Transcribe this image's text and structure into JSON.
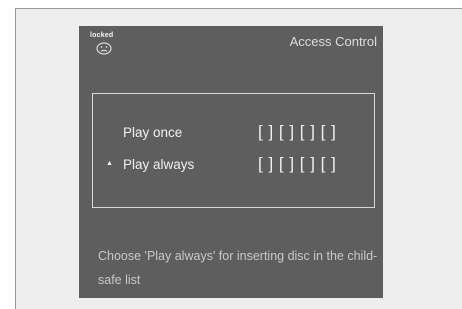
{
  "screen": {
    "title": "Access Control",
    "lock_status": {
      "label": "locked",
      "icon": "sad-face-icon"
    },
    "options": [
      {
        "label": "Play once",
        "code_slots": "[ ] [ ] [ ] [ ]",
        "selected": false
      },
      {
        "label": "Play always",
        "code_slots": "[ ] [ ] [ ] [ ]",
        "selected": true,
        "selector_glyph": "▲"
      }
    ],
    "help_text": "Choose 'Play always' for inserting disc in the child-safe list"
  },
  "colors": {
    "screen_background": "#5e5e5e",
    "outer_frame": "#eeeeee",
    "text": "#f0f0f0",
    "help_text": "#c8c8c8",
    "panel_border": "#d8d8d8"
  }
}
